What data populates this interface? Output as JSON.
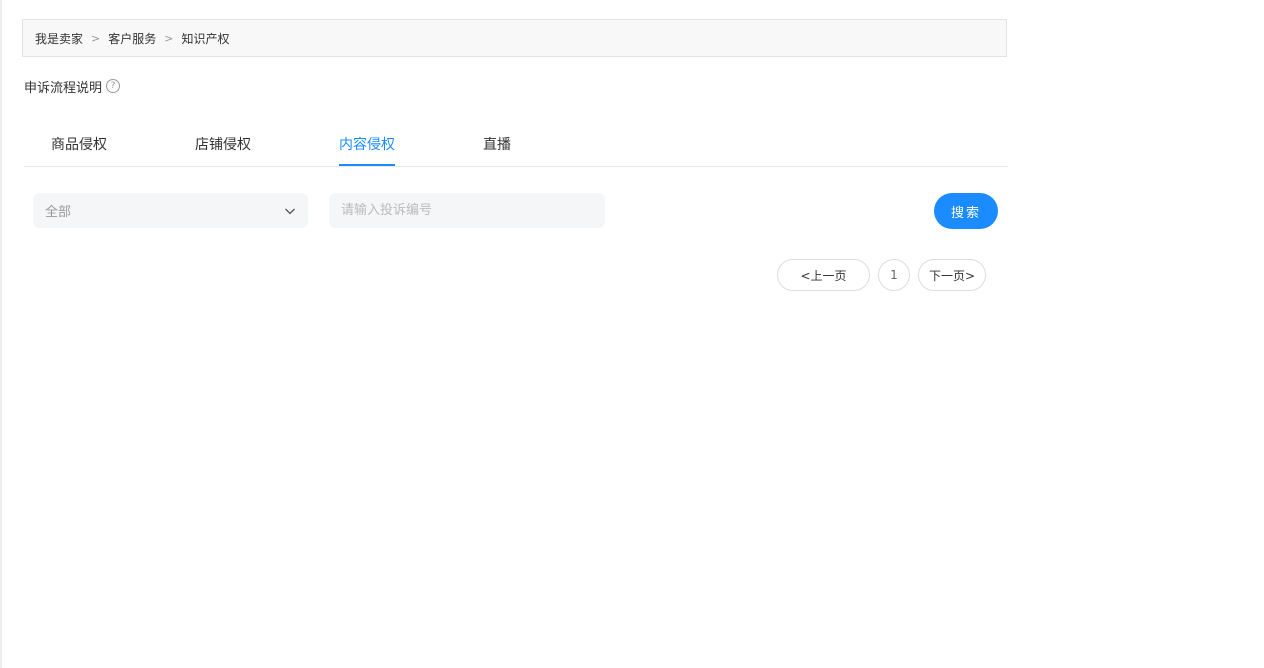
{
  "breadcrumb": {
    "items": [
      "我是卖家",
      "客户服务",
      "知识产权"
    ],
    "separator": ">"
  },
  "process_link": {
    "label": "申诉流程说明",
    "help_icon": "?"
  },
  "tabs": [
    {
      "label": "商品侵权",
      "active": false
    },
    {
      "label": "店铺侵权",
      "active": false
    },
    {
      "label": "内容侵权",
      "active": true
    },
    {
      "label": "直播",
      "active": false
    }
  ],
  "filter": {
    "select_value": "全部",
    "search_placeholder": "请输入投诉编号",
    "search_value": "",
    "search_button": "搜索"
  },
  "pagination": {
    "prev": "<上一页",
    "current_page": "1",
    "next": "下一页>"
  },
  "colors": {
    "accent": "#1a8cff",
    "input_bg": "#f5f6f8",
    "breadcrumb_bg": "#f8f8f8"
  }
}
